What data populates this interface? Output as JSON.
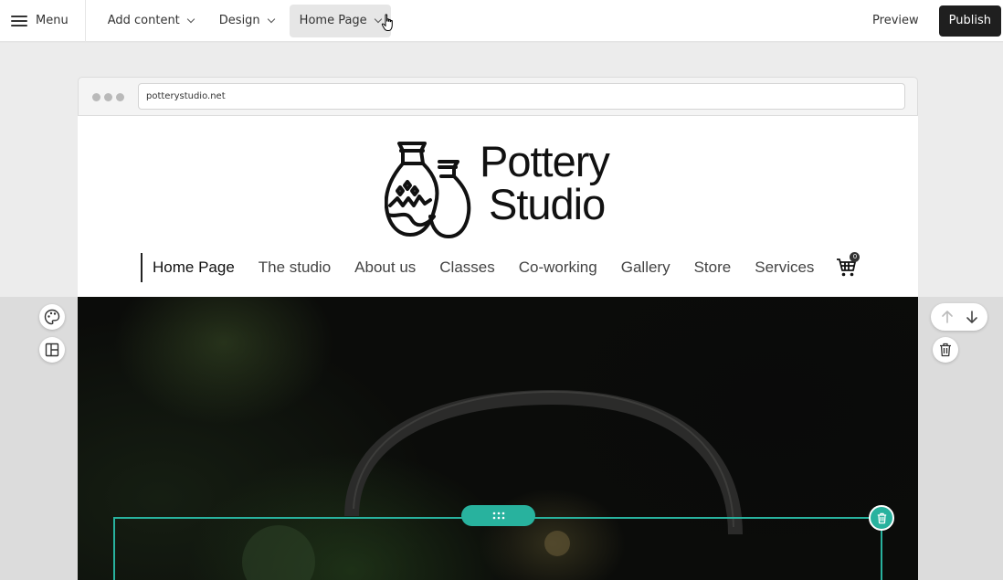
{
  "toolbar": {
    "menu_label": "Menu",
    "add_content_label": "Add content",
    "design_label": "Design",
    "page_select_label": "Home Page",
    "preview_label": "Preview",
    "publish_label": "Publish"
  },
  "browser": {
    "url": "potterystudio.net"
  },
  "site": {
    "logo_line1": "Pottery",
    "logo_line2": "Studio",
    "nav": [
      {
        "label": "Home Page"
      },
      {
        "label": "The studio"
      },
      {
        "label": "About us"
      },
      {
        "label": "Classes"
      },
      {
        "label": "Co-working"
      },
      {
        "label": "Gallery"
      },
      {
        "label": "Store"
      },
      {
        "label": "Services"
      }
    ],
    "cart_count": "0"
  },
  "icons": {
    "left_tools": [
      "palette-icon",
      "layout-icon"
    ],
    "right_tools": [
      "arrow-up-icon",
      "arrow-down-icon",
      "trash-icon"
    ],
    "selection": [
      "drag-grid-icon",
      "trash-icon"
    ]
  },
  "colors": {
    "accent": "#28b29e",
    "publish_bg": "#1f1f1f"
  }
}
